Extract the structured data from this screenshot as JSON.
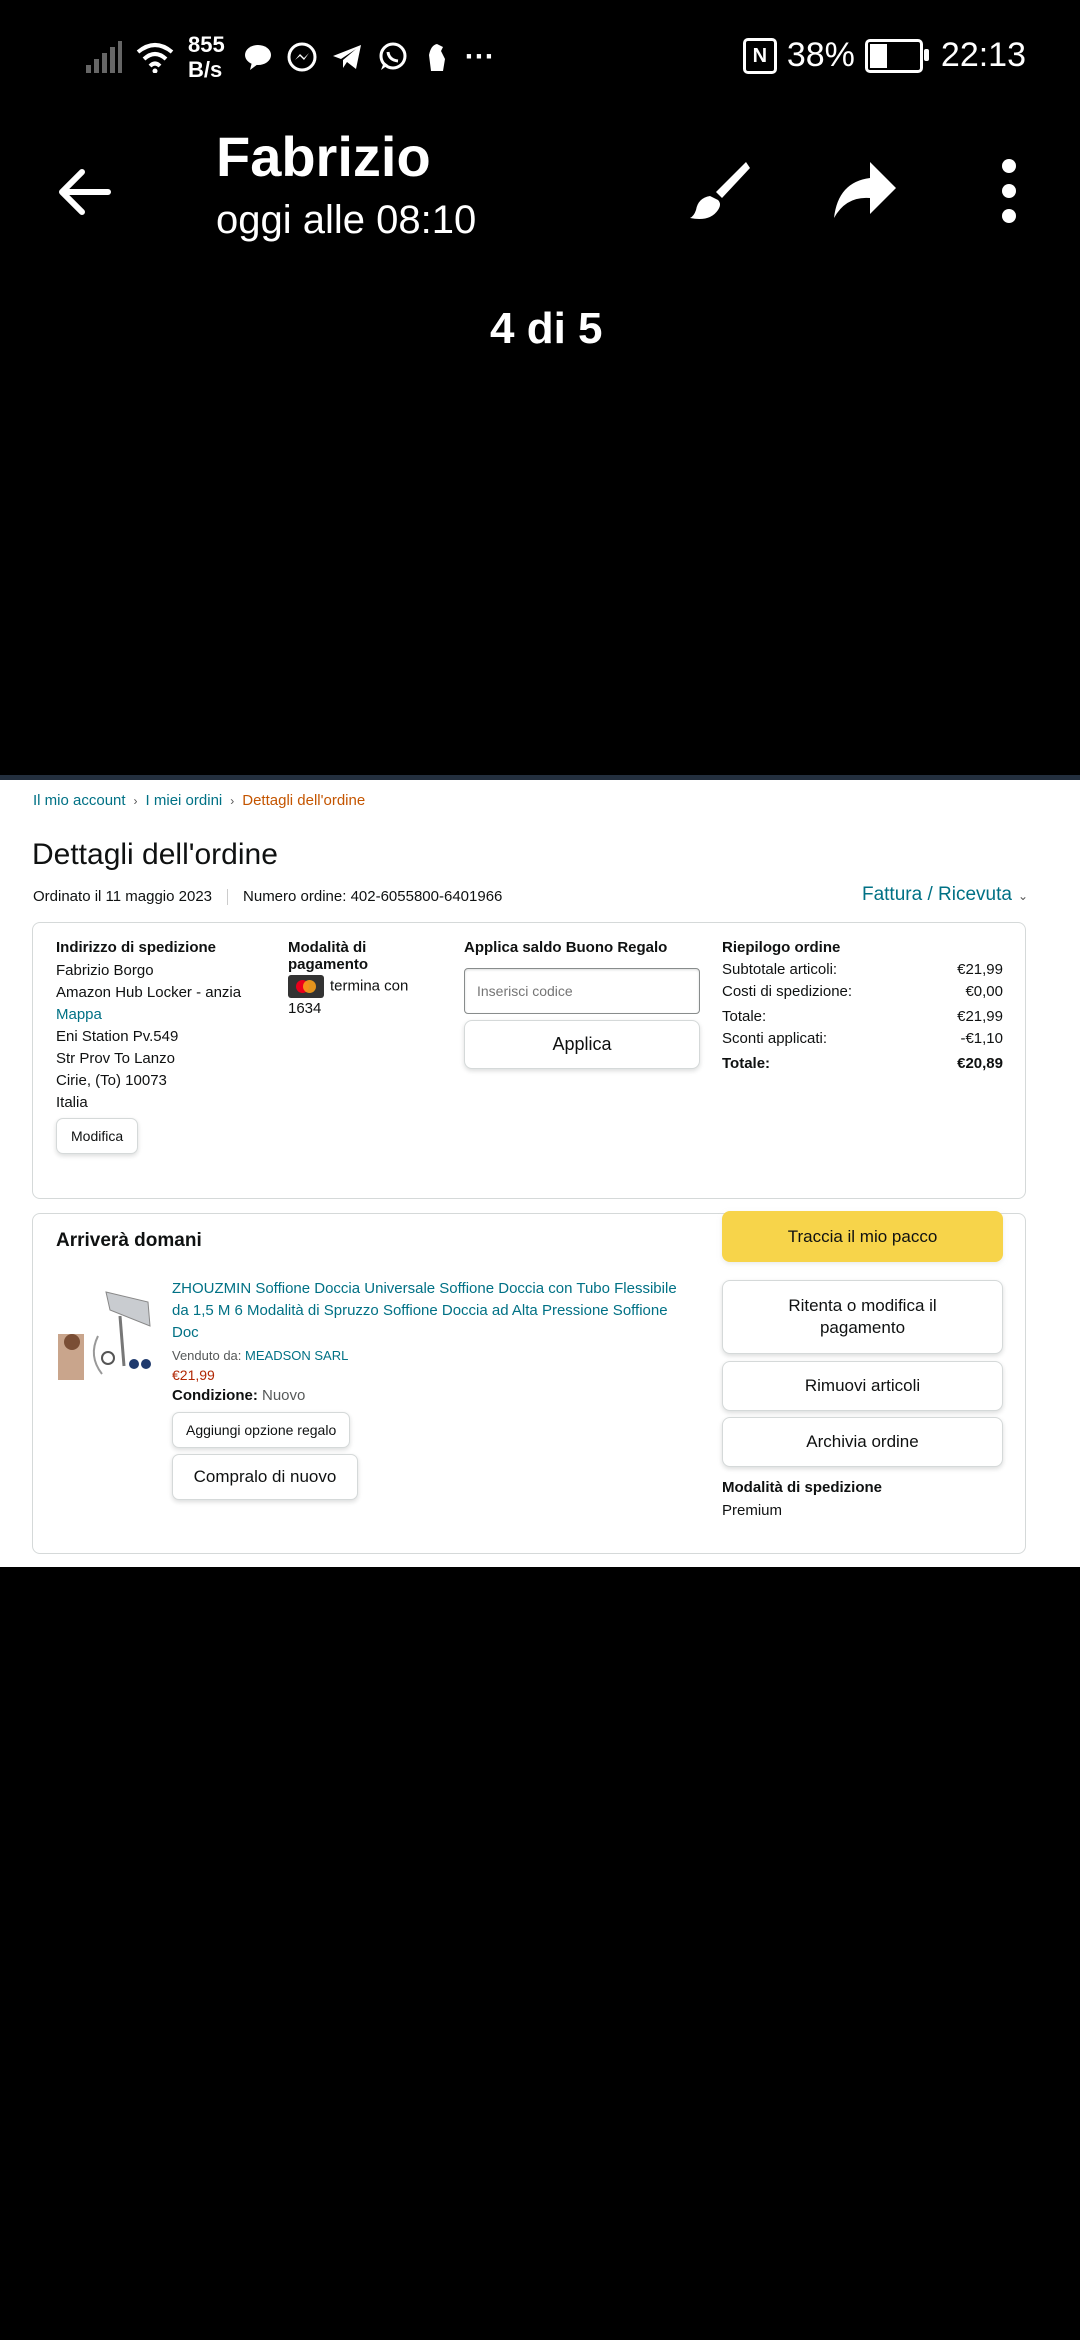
{
  "status_bar": {
    "net_speed_value": "855",
    "net_speed_unit": "B/s",
    "nfc_label": "N",
    "battery_percent": "38%",
    "battery_level": 0.38,
    "time": "22:13",
    "overflow": "···",
    "icons": [
      "signal-icon",
      "wifi-icon",
      "chat-bubble-icon",
      "messenger-icon",
      "telegram-icon",
      "whatsapp-icon",
      "notification-icon",
      "nfc-icon",
      "battery-charging-icon"
    ]
  },
  "viewer": {
    "title": "Fabrizio",
    "subtitle": "oggi alle 08:10",
    "counter": "4 di 5",
    "icons": [
      "back-arrow-icon",
      "brush-icon",
      "share-icon",
      "more-vert-icon"
    ]
  },
  "order": {
    "breadcrumb": [
      "Il mio account",
      "I miei ordini",
      "Dettagli dell'ordine"
    ],
    "heading": "Dettagli dell'ordine",
    "ordered_on": "Ordinato il 11 maggio 2023",
    "order_number": "Numero ordine: 402-6055800-6401966",
    "invoice_link": "Fattura / Ricevuta",
    "shipping": {
      "label": "Indirizzo di spedizione",
      "name": "Fabrizio Borgo",
      "locker": "Amazon Hub Locker - anzia",
      "map_link": "Mappa",
      "line1": "Eni Station Pv.549",
      "line2": "Str Prov To Lanzo",
      "line3": "Cirie, (To) 10073",
      "country": "Italia",
      "edit_button": "Modifica"
    },
    "payment": {
      "label": "Modalità di pagamento",
      "card_text": "termina con 1634",
      "card_brand_icon": "mastercard-icon"
    },
    "gift_card": {
      "label": "Applica saldo Buono Regalo",
      "placeholder": "Inserisci codice",
      "apply_button": "Applica"
    },
    "summary": {
      "label": "Riepilogo ordine",
      "rows": [
        {
          "label": "Subtotale articoli:",
          "value": "€21,99"
        },
        {
          "label": "Costi di spedizione:",
          "value": "€0,00"
        },
        {
          "label": "Totale:",
          "value": "€21,99"
        },
        {
          "label": "Sconti applicati:",
          "value": "-€1,10"
        }
      ],
      "grand_total_label": "Totale:",
      "grand_total_value": "€20,89"
    },
    "shipment": {
      "arrival": "Arriverà domani",
      "product_title": "ZHOUZMIN Soffione Doccia Universale Soffione Doccia con Tubo Flessibile da 1,5 M 6 Modalità di Spruzzo Soffione Doccia ad Alta Pressione Soffione Doc",
      "sold_by_label": "Venduto da:",
      "seller": "MEADSON SARL",
      "price": "€21,99",
      "condition_label": "Condizione:",
      "condition_value": "Nuovo",
      "gift_option_button": "Aggiungi opzione regalo",
      "buy_again_button": "Compralo di nuovo",
      "track_button": "Traccia il mio pacco",
      "retry_payment_button": "Ritenta o modifica il pagamento",
      "remove_items_button": "Rimuovi articoli",
      "archive_button": "Archivia ordine",
      "shipping_mode_label": "Modalità di spedizione",
      "shipping_mode_value": "Premium"
    }
  }
}
